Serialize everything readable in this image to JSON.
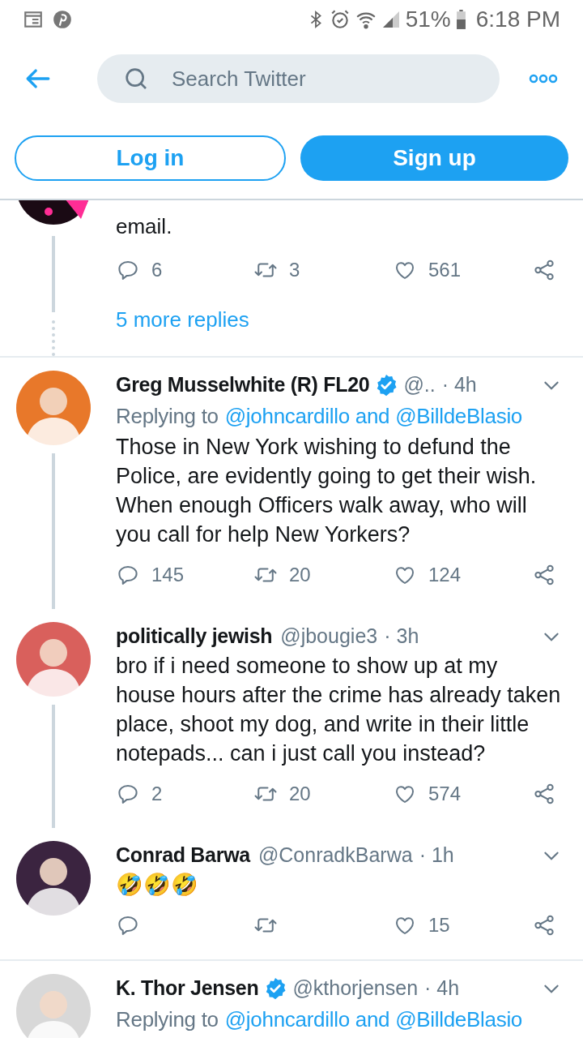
{
  "status_bar": {
    "battery": "51%",
    "time": "6:18 PM"
  },
  "header": {
    "search": {
      "placeholder": "Search Twitter"
    },
    "buttons": [
      {
        "label": "Log in",
        "kind": "outline"
      },
      {
        "label": "Sign up",
        "kind": "filled"
      }
    ]
  },
  "partial_tweet": {
    "body": "email.",
    "counts": {
      "reply": "6",
      "retweet": "3",
      "like": "561"
    },
    "more_replies": "5 more replies"
  },
  "tweets": [
    {
      "name": "Greg Musselwhite (R) FL20",
      "verified": true,
      "handle": "@..",
      "time": "· 4h",
      "replying_label": "Replying to",
      "replying_to": "@johncardillo and @BilldeBlasio",
      "body": "Those in New York wishing to defund the Police, are evidently going to get their wish. When enough Officers walk away, who will you call for help New Yorkers?",
      "counts": {
        "reply": "145",
        "retweet": "20",
        "like": "124"
      },
      "threaded": true,
      "color": "#e8782a"
    },
    {
      "name": "politically jewish",
      "verified": false,
      "handle": "@jbougie3",
      "time": "· 3h",
      "body": "bro if i need someone to show up at my house hours after the crime has already taken place, shoot my dog, and write in their little notepads... can i just call you instead?",
      "counts": {
        "reply": "2",
        "retweet": "20",
        "like": "574"
      },
      "threaded": true,
      "color": "#d9605c"
    },
    {
      "name": "Conrad Barwa",
      "verified": false,
      "handle": "@ConradkBarwa",
      "time": "· 1h",
      "body": "🤣🤣🤣",
      "counts": {
        "like": "15"
      },
      "threaded": false,
      "color": "#3b2440"
    },
    {
      "name": "K. Thor Jensen",
      "verified": true,
      "handle": "@kthorjensen",
      "time": "· 4h",
      "replying_label": "Replying to",
      "replying_to": "@johncardillo and @BilldeBlasio",
      "threaded": false,
      "color": "#d8d8d8"
    }
  ]
}
